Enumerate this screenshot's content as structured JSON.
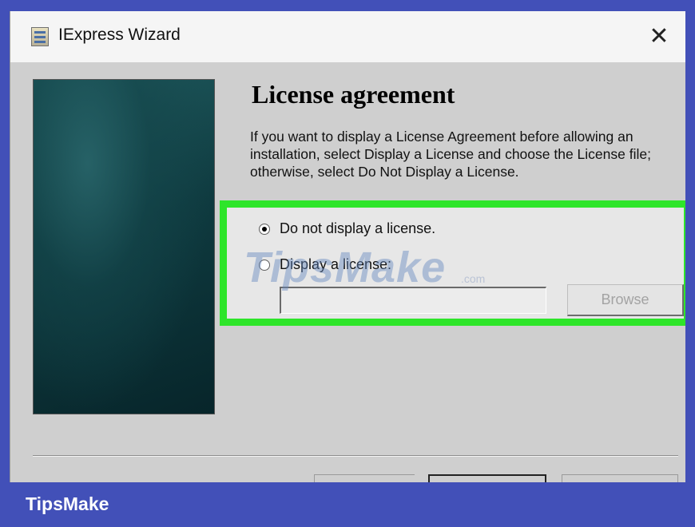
{
  "window": {
    "title": "IExpress Wizard",
    "close_label": "✕"
  },
  "page": {
    "heading": "License agreement",
    "description": "If you want to display a License Agreement before allowing an installation, select Display a License and choose the License file; otherwise, select Do Not Display a License."
  },
  "options": {
    "no_license_label": "Do not display a license.",
    "no_license_selected": true,
    "display_license_label": "Display a license:",
    "display_license_selected": false,
    "license_file_value": "",
    "browse_label": "Browse"
  },
  "watermark": {
    "text": "TipsMake",
    "suffix": ".com"
  },
  "footer": {
    "brand": "TipsMake"
  },
  "colors": {
    "brand_blue": "#4250b8",
    "highlight_green": "#2ee52a",
    "dialog_gray": "#cfcfcf"
  }
}
